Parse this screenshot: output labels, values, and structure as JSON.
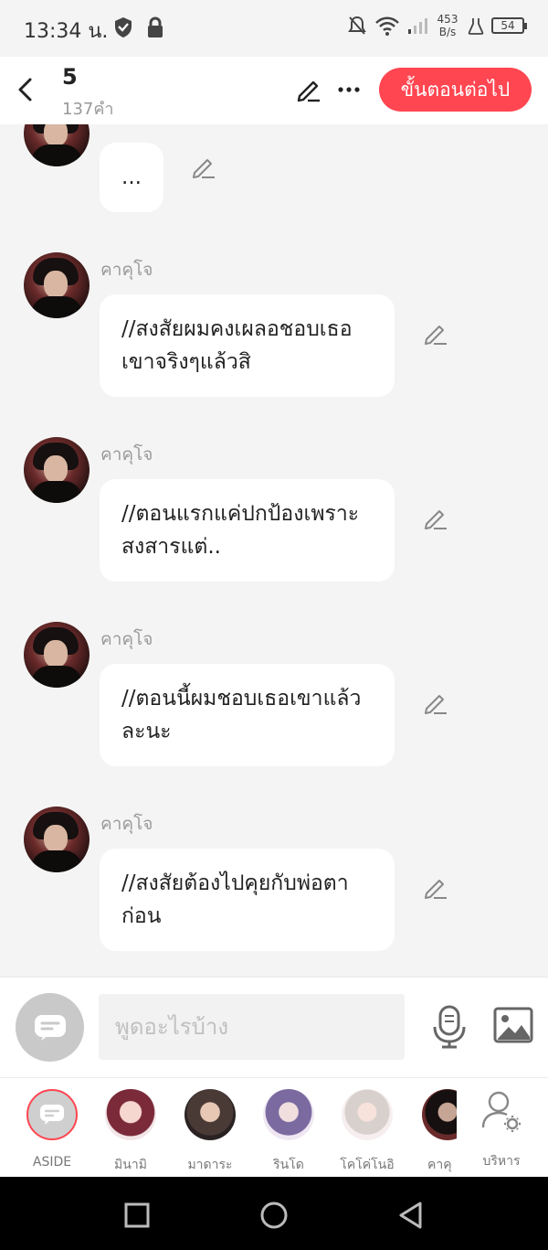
{
  "status_bar": {
    "time": "13:34 น.",
    "net_speed_value": "453",
    "net_speed_unit": "B/s",
    "battery": "54"
  },
  "header": {
    "title": "5",
    "word_count": "137คำ",
    "next_button": "ขั้นตอนต่อไป"
  },
  "messages": [
    {
      "speaker": "",
      "text": "..."
    },
    {
      "speaker": "คาคุโจ",
      "text": "//สงสัยผมคงเผลอชอบเธอเขาจริงๆแล้วสิ"
    },
    {
      "speaker": "คาคุโจ",
      "text": "//ตอนแรกแค่ปกป้องเพราะสงสารแต่.."
    },
    {
      "speaker": "คาคุโจ",
      "text": "//ตอนนี้ผมชอบเธอเขาแล้วละนะ"
    },
    {
      "speaker": "คาคุโจ",
      "text": "//สงสัยต้องไปคุยกับพ่อตาก่อน"
    }
  ],
  "input": {
    "placeholder": "พูดอะไรบ้าง"
  },
  "characters": [
    {
      "name": "ASIDE"
    },
    {
      "name": "มินามิ"
    },
    {
      "name": "มาดาระ"
    },
    {
      "name": "รินโด"
    },
    {
      "name": "โคโค่โนอิ"
    },
    {
      "name": "คาคุ"
    }
  ],
  "manage_label": "บริหาร",
  "colors": {
    "accent": "#ff4651",
    "background": "#f4f4f4"
  }
}
